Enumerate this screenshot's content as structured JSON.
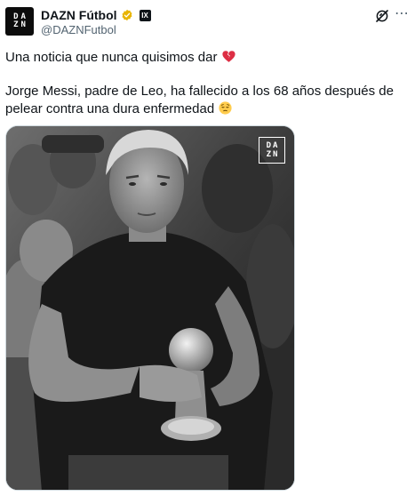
{
  "account": {
    "name": "DAZN Fútbol",
    "handle": "@DAZNFutbol",
    "avatar_text_top": "DA",
    "avatar_text_bottom": "ZN",
    "affiliate_badge": "IX",
    "verified_color": "#e8b400"
  },
  "tweet": {
    "line1": "Una noticia que nunca quisimos dar",
    "line2": "Jorge Messi, padre de Leo, ha fallecido a los 68 años después de pelear contra una dura enfermedad",
    "emoji1": "broken-heart",
    "emoji2": "pensive-face"
  },
  "media": {
    "watermark_top": "DA",
    "watermark_bottom": "ZN",
    "style": "black-and-white photo"
  },
  "icons": {
    "grok": "grok-icon",
    "more": "more-icon"
  }
}
